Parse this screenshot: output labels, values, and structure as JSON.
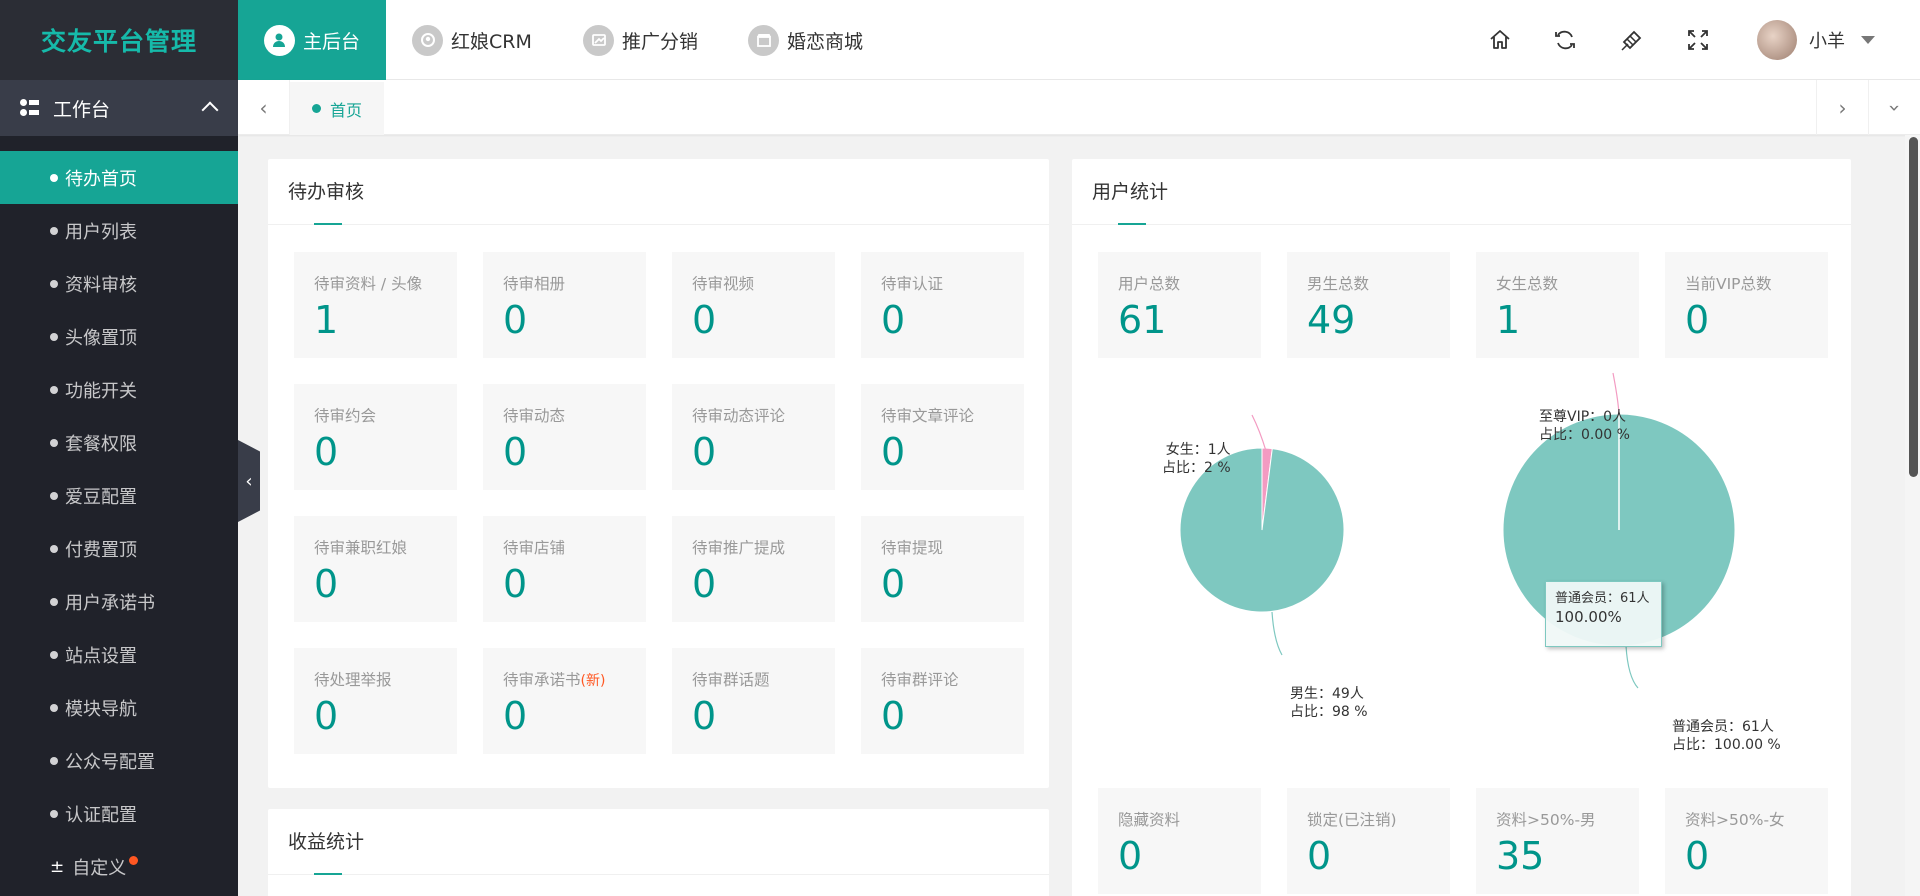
{
  "app": {
    "title": "交友平台管理"
  },
  "sidebar": {
    "workspace": "工作台",
    "items": [
      {
        "label": "待办首页",
        "active": true
      },
      {
        "label": "用户列表"
      },
      {
        "label": "资料审核"
      },
      {
        "label": "头像置顶"
      },
      {
        "label": "功能开关"
      },
      {
        "label": "套餐权限"
      },
      {
        "label": "爱豆配置"
      },
      {
        "label": "付费置顶"
      },
      {
        "label": "用户承诺书"
      },
      {
        "label": "站点设置"
      },
      {
        "label": "模块导航"
      },
      {
        "label": "公众号配置"
      },
      {
        "label": "认证配置"
      }
    ],
    "custom": "自定义"
  },
  "topnav": {
    "tabs": [
      "主后台",
      "红娘CRM",
      "推广分销",
      "婚恋商城"
    ],
    "user": "小羊"
  },
  "pagetabs": {
    "home": "首页"
  },
  "pending": {
    "title": "待办审核",
    "items": [
      {
        "label": "待审资料 / 头像",
        "value": "1"
      },
      {
        "label": "待审相册",
        "value": "0"
      },
      {
        "label": "待审视频",
        "value": "0"
      },
      {
        "label": "待审认证",
        "value": "0"
      },
      {
        "label": "待审约会",
        "value": "0"
      },
      {
        "label": "待审动态",
        "value": "0"
      },
      {
        "label": "待审动态评论",
        "value": "0"
      },
      {
        "label": "待审文章评论",
        "value": "0"
      },
      {
        "label": "待审兼职红娘",
        "value": "0"
      },
      {
        "label": "待审店铺",
        "value": "0"
      },
      {
        "label": "待审推广提成",
        "value": "0"
      },
      {
        "label": "待审提现",
        "value": "0"
      },
      {
        "label": "待处理举报",
        "value": "0"
      },
      {
        "label": "待审承诺书",
        "value": "0",
        "badge": "(新)"
      },
      {
        "label": "待审群话题",
        "value": "0"
      },
      {
        "label": "待审群评论",
        "value": "0"
      }
    ]
  },
  "income": {
    "title": "收益统计"
  },
  "userstats": {
    "title": "用户统计",
    "top": [
      {
        "label": "用户总数",
        "value": "61"
      },
      {
        "label": "男生总数",
        "value": "49"
      },
      {
        "label": "女生总数",
        "value": "1"
      },
      {
        "label": "当前VIP总数",
        "value": "0"
      }
    ],
    "bottom": [
      {
        "label": "隐藏资料",
        "value": "0"
      },
      {
        "label": "锁定(已注销)",
        "value": "0"
      },
      {
        "label": "资料>50%-男",
        "value": "35"
      },
      {
        "label": "资料>50%-女",
        "value": "0"
      }
    ]
  },
  "colors": {
    "accent": "#16a595",
    "pie_teal": "#7ec8c0",
    "pie_pink": "#f39bc2",
    "badge": "#ff5722"
  },
  "chart_data": [
    {
      "type": "pie",
      "slices": [
        {
          "name": "女生",
          "value": 1,
          "percent": 2,
          "color": "#f39bc2"
        },
        {
          "name": "男生",
          "value": 49,
          "percent": 98,
          "color": "#7ec8c0"
        }
      ],
      "labels": [
        {
          "line1": "女生：1人",
          "line2": "占比：2 %"
        },
        {
          "line1": "男生：49人",
          "line2": "占比：98 %"
        }
      ]
    },
    {
      "type": "pie",
      "slices": [
        {
          "name": "至尊VIP",
          "value": 0,
          "percent": 0.0,
          "color": "#f39bc2"
        },
        {
          "name": "普通会员",
          "value": 61,
          "percent": 100.0,
          "color": "#7ec8c0"
        }
      ],
      "labels": [
        {
          "line1": "至尊VIP：0人",
          "line2": "占比：0.00 %"
        },
        {
          "line1": "普通会员：61人",
          "line2": "占比：100.00 %"
        }
      ],
      "tooltip": {
        "line1": "普通会员：61人",
        "line2": "100.00%"
      }
    }
  ]
}
